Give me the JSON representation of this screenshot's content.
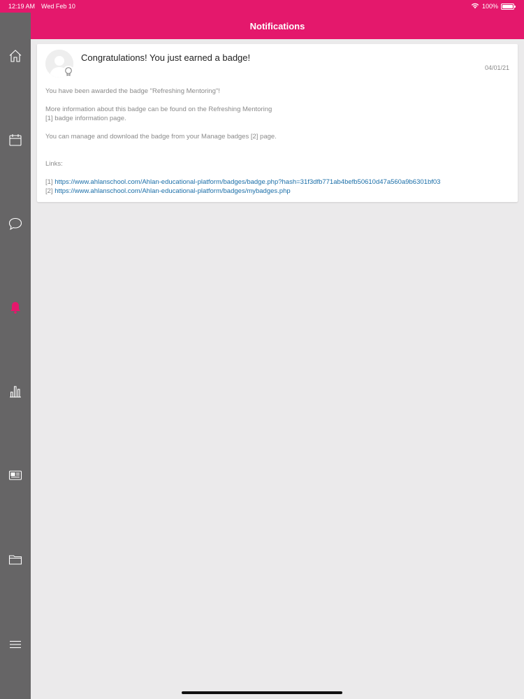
{
  "status_bar": {
    "time": "12:19 AM",
    "date": "Wed Feb 10",
    "battery": "100%",
    "battery_level": 1.0,
    "wifi_icon": "wifi-icon"
  },
  "header": {
    "title": "Notifications",
    "background": "#e4186c"
  },
  "sidebar": {
    "background": "#666566",
    "active_color": "#e4186c",
    "items": [
      {
        "icon": "home-icon",
        "active": false
      },
      {
        "icon": "calendar-icon",
        "active": false
      },
      {
        "icon": "chat-bubble-icon",
        "active": false
      },
      {
        "icon": "bell-icon",
        "active": true
      },
      {
        "icon": "bar-chart-icon",
        "active": false
      },
      {
        "icon": "newspaper-icon",
        "active": false
      },
      {
        "icon": "folder-icon",
        "active": false
      },
      {
        "icon": "menu-icon",
        "active": false
      }
    ]
  },
  "notification": {
    "title": "Congratulations! You just earned a badge!",
    "date": "04/01/21",
    "avatar_icon": "user-avatar-icon",
    "badge_icon": "badge-icon",
    "body": {
      "line1": "You have been awarded the badge \"Refreshing Mentoring\"!",
      "line2": "More information about this badge can be found on the Refreshing Mentoring",
      "line3": "[1] badge information page.",
      "line4": "You can manage and download the badge from your Manage badges [2] page.",
      "links_label": "Links:",
      "links": [
        {
          "num": "[1]",
          "url": "https://www.ahlanschool.com/Ahlan-educational-platform/badges/badge.php?hash=31f3dfb771ab4befb50610d47a560a9b6301bf03"
        },
        {
          "num": "[2]",
          "url": "https://www.ahlanschool.com/Ahlan-educational-platform/badges/mybadges.php"
        }
      ]
    }
  }
}
